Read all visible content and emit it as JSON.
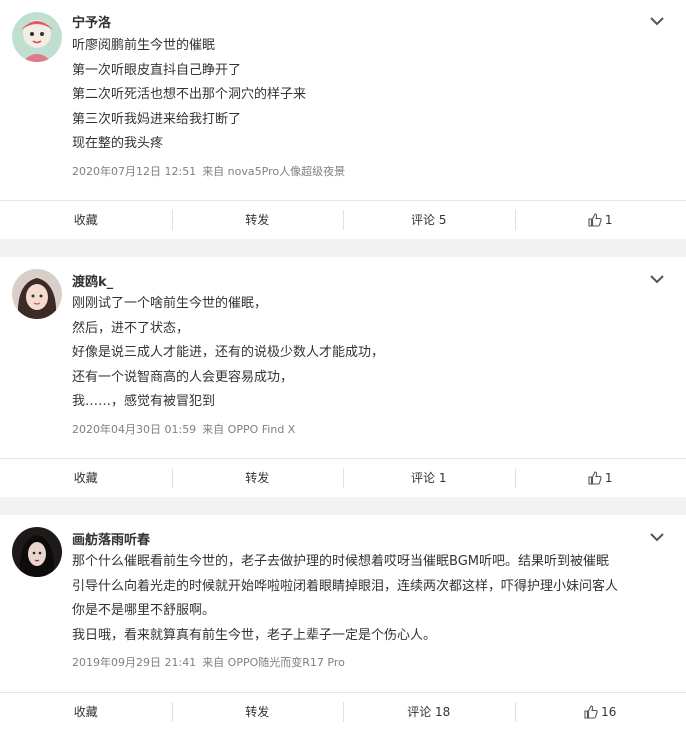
{
  "comments": [
    {
      "name": "宁予洛",
      "lines": [
        "听廖阅鹏前生今世的催眠",
        "第一次听眼皮直抖自己睁开了",
        "第二次听死活也想不出那个洞穴的样子来",
        "第三次听我妈进来给我打断了",
        "现在整的我头疼"
      ],
      "time": "2020年07月12日 12:51",
      "source": "来自 nova5Pro人像超级夜景",
      "actions": {
        "collect": "收藏",
        "repost": "转发",
        "comment": "评论 5",
        "likes": "1"
      }
    },
    {
      "name": "渡鸥k_",
      "lines": [
        "刚刚试了一个啥前生今世的催眠，",
        "然后，进不了状态，",
        "好像是说三成人才能进，还有的说极少数人才能成功，",
        "还有一个说智商高的人会更容易成功，",
        "我……，感觉有被冒犯到"
      ],
      "time": "2020年04月30日 01:59",
      "source": "来自 OPPO Find X",
      "actions": {
        "collect": "收藏",
        "repost": "转发",
        "comment": "评论 1",
        "likes": "1"
      }
    },
    {
      "name": "画舫落雨听春",
      "lines": [
        "那个什么催眠看前生今世的，老子去做护理的时候想着哎呀当催眠BGM听吧。结果听到被催眠",
        "引导什么向着光走的时候就开始哗啦啦闭着眼睛掉眼泪，连续两次都这样，吓得护理小妹问客人",
        "你是不是哪里不舒服啊。",
        "我日哦，看来就算真有前生今世，老子上辈子一定是个伤心人。"
      ],
      "time": "2019年09月29日 21:41",
      "source": "来自 OPPO随光而变R17 Pro",
      "actions": {
        "collect": "收藏",
        "repost": "转发",
        "comment": "评论 18",
        "likes": "16"
      }
    }
  ]
}
